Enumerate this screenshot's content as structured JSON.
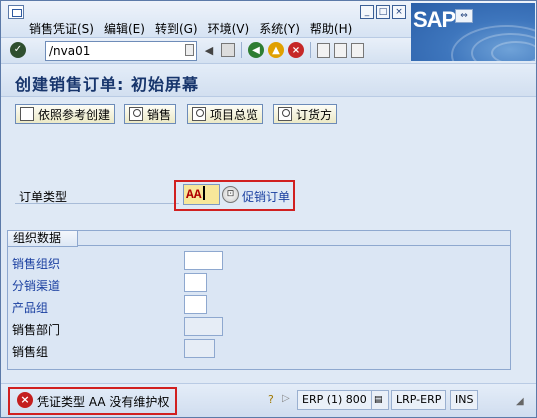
{
  "menu": {
    "items": [
      "销售凭证(S)",
      "编辑(E)",
      "转到(G)",
      "环境(V)",
      "系统(Y)",
      "帮助(H)"
    ]
  },
  "window_buttons": [
    "_",
    "□",
    "×"
  ],
  "logo": {
    "text": "SAP",
    "tag": "⇔"
  },
  "toolbar": {
    "command": "/nva01",
    "icons": [
      "enter-icon",
      "save-icon",
      "back-icon",
      "exit-icon",
      "cancel-icon",
      "print-icon",
      "find-icon",
      "find-next-icon"
    ]
  },
  "title": "创建销售订单: 初始屏幕",
  "app_toolbar": {
    "buttons": [
      {
        "label": "依照参考创建",
        "icon": "copy-icon"
      },
      {
        "label": "销售",
        "icon": "person-icon"
      },
      {
        "label": "项目总览",
        "icon": "person-icon"
      },
      {
        "label": "订货方",
        "icon": "person-icon"
      }
    ]
  },
  "order_type": {
    "label": "订单类型",
    "value": "AA",
    "description": "促销订单"
  },
  "org_data": {
    "title": "组织数据",
    "fields": [
      {
        "label": "销售组织",
        "value": ""
      },
      {
        "label": "分销渠道",
        "value": ""
      },
      {
        "label": "产品组",
        "value": ""
      },
      {
        "label": "销售部门",
        "value": ""
      },
      {
        "label": "销售组",
        "value": ""
      }
    ]
  },
  "status": {
    "message": "凭证类型 AA 没有维护权",
    "system": "ERP (1) 800",
    "server": "LRP-ERP",
    "mode": "INS"
  },
  "colors": {
    "highlight_border": "#d12020",
    "title_text": "#17356c",
    "link_text": "#1a3fa0",
    "input_highlight": "#f7e79a"
  }
}
